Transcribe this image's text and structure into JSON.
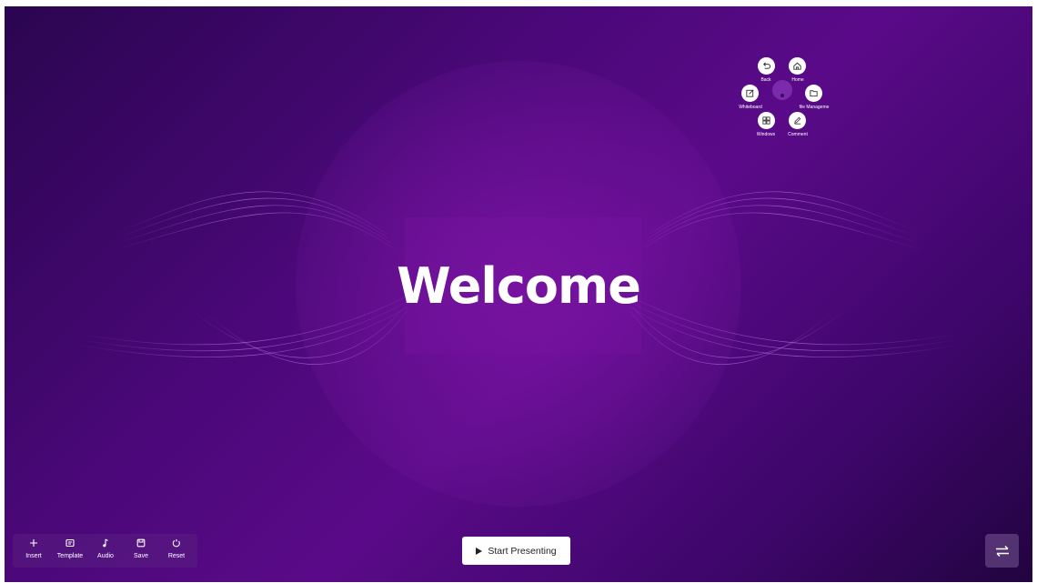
{
  "slide": {
    "title": "Welcome"
  },
  "radial_menu": {
    "items": [
      {
        "label": "Back",
        "icon": "undo-icon"
      },
      {
        "label": "Home",
        "icon": "home-icon"
      },
      {
        "label": "Whiteboard",
        "icon": "edit-box-icon"
      },
      {
        "label": "file Manageme",
        "icon": "folder-icon"
      },
      {
        "label": "Windows",
        "icon": "grid-icon"
      },
      {
        "label": "Comment",
        "icon": "pen-icon"
      }
    ]
  },
  "toolbar": {
    "items": [
      {
        "label": "Insert",
        "icon": "plus-icon"
      },
      {
        "label": "Template",
        "icon": "template-icon"
      },
      {
        "label": "Audio",
        "icon": "music-note-icon"
      },
      {
        "label": "Save",
        "icon": "save-icon"
      },
      {
        "label": "Reset",
        "icon": "reset-icon"
      }
    ]
  },
  "start_button": {
    "label": "Start Presenting",
    "icon": "play-icon"
  },
  "switch_button": {
    "icon": "swap-arrows-icon"
  },
  "colors": {
    "background_dark": "#2a0550",
    "background_mid": "#5a0a88",
    "text": "#ffffff"
  }
}
